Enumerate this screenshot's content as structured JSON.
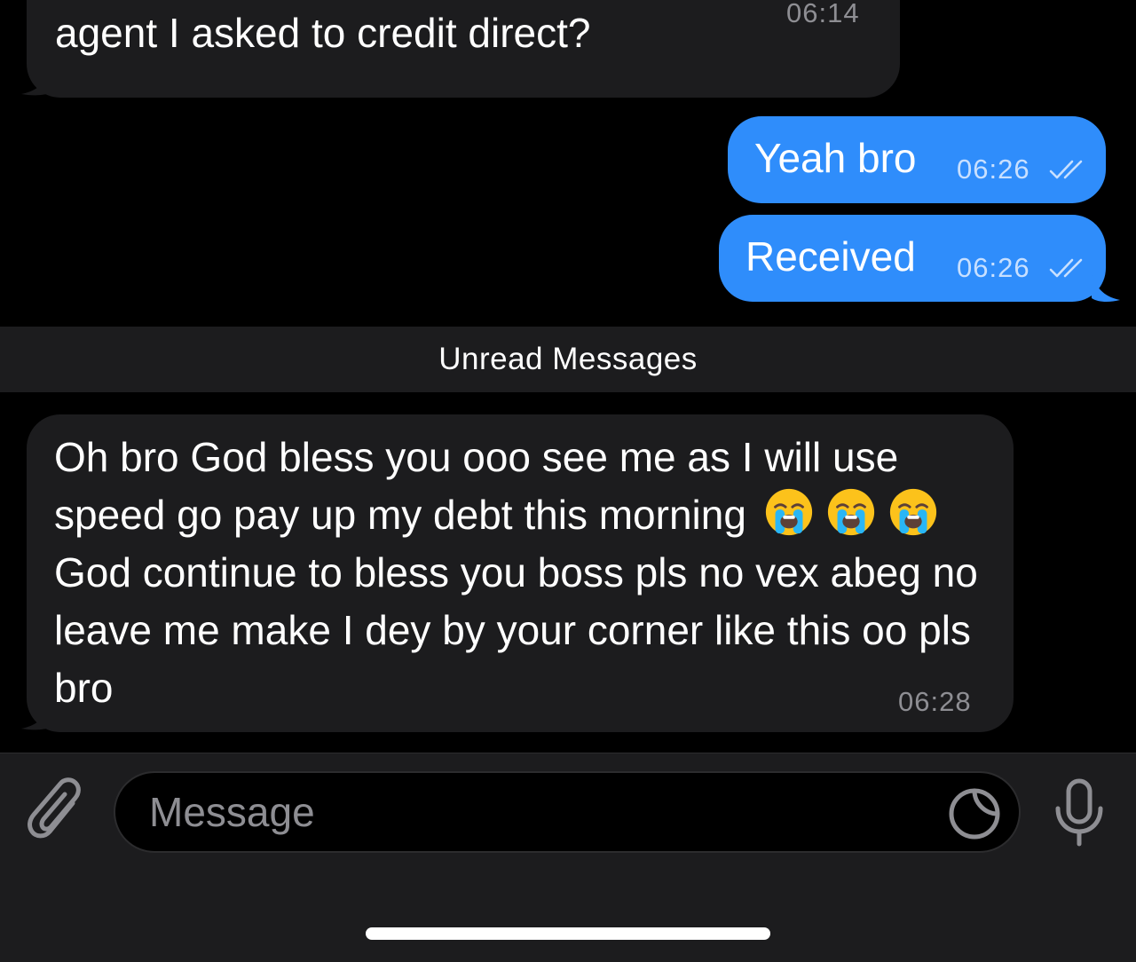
{
  "colors": {
    "background": "#000000",
    "incoming_bubble": "#1c1c1e",
    "outgoing_bubble": "#2f8dfb",
    "timestamp_gray": "#8e8e93",
    "timestamp_on_blue": "#c8e0ff",
    "emoji_face": "#fcc21b",
    "emoji_tears": "#29b6f6"
  },
  "messages": [
    {
      "direction": "incoming",
      "text": "Bro pls have you got it because it’s the\nagent I asked to credit direct?",
      "time": "06:14"
    },
    {
      "direction": "outgoing",
      "text": "Yeah bro",
      "time": "06:26",
      "status_icon": "double-check-icon"
    },
    {
      "direction": "outgoing",
      "text": "Received",
      "time": "06:26",
      "status_icon": "double-check-icon"
    }
  ],
  "unread_divider": {
    "label": "Unread Messages"
  },
  "unread_message": {
    "direction": "incoming",
    "text_before_emojis": "Oh bro God bless you ooo see me as I will use speed go pay up my debt this morning",
    "emojis": [
      "loudly-crying-face-emoji",
      "loudly-crying-face-emoji",
      "loudly-crying-face-emoji"
    ],
    "text_after_emojis": "God continue to bless you boss pls no vex abeg no leave me make I dey by your corner like this oo pls bro",
    "time": "06:28"
  },
  "input_bar": {
    "placeholder": "Message",
    "attach_icon": "paperclip-icon",
    "sticker_icon": "sticker-icon",
    "mic_icon": "microphone-icon"
  }
}
